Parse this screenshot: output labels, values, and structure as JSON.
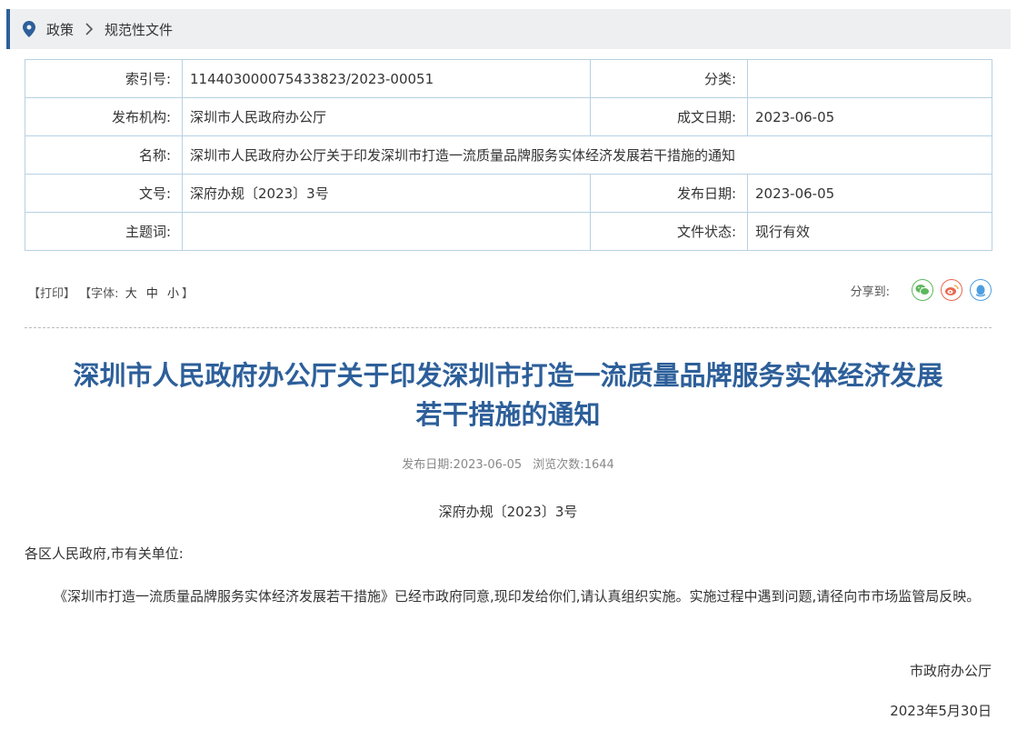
{
  "breadcrumb": {
    "icon": "location-pin-icon",
    "items": [
      "政策",
      "规范性文件"
    ]
  },
  "meta": {
    "index_label": "索引号:",
    "index_value": "11440300007543382 3/2023-00051",
    "category_label": "分类:",
    "category_value": "",
    "publisher_label": "发布机构:",
    "publisher_value": "深圳市人民政府办公厅",
    "written_date_label": "成文日期:",
    "written_date_value": "2023-06-05",
    "name_label": "名称:",
    "name_value": "深圳市人民政府办公厅关于印发深圳市打造一流质量品牌服务实体经济发展若干措施的通知",
    "docno_label": "文号:",
    "docno_value": "深府办规〔2023〕3号",
    "pubdate_label": "发布日期:",
    "pubdate_value": "2023-06-05",
    "keywords_label": "主题词:",
    "keywords_value": "",
    "status_label": "文件状态:",
    "status_value": "现行有效"
  },
  "tools": {
    "print": "【打印】",
    "font_open": "【字体:",
    "font_large": "大",
    "font_medium": "中",
    "font_small": "小",
    "font_close": "】",
    "share_label": "分享到:",
    "share_icons": [
      "wechat-icon",
      "weibo-icon",
      "qq-icon"
    ]
  },
  "article": {
    "title_line1": "深圳市人民政府办公厅关于印发深圳市打造一流质量品牌服务实体经济发展",
    "title_line2": "若干措施的通知",
    "pub_date_label": "发布日期:",
    "pub_date": "2023-06-05",
    "views_label": "浏览次数:",
    "views": "1644",
    "doc_number": "深府办规〔2023〕3号",
    "salutation": "各区人民政府,市有关单位:",
    "body": "《深圳市打造一流质量品牌服务实体经济发展若干措施》已经市政府同意,现印发给你们,请认真组织实施。实施过程中遇到问题,请径向市市场监管局反映。",
    "signature": "市政府办公厅",
    "date": "2023年5月30日"
  },
  "colors": {
    "accent": "#2d5f9a",
    "table_border": "#b8d1e3",
    "breadcrumb_bg": "#eeeff1"
  }
}
